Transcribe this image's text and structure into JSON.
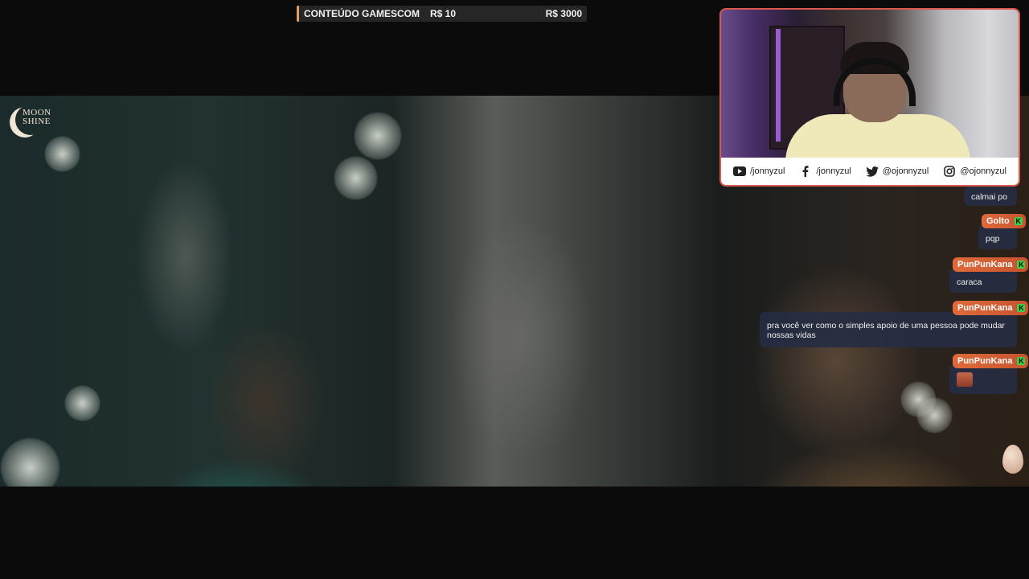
{
  "goal": {
    "title": "CONTEÚDO GAMESCOM",
    "current": "R$ 10",
    "target": "R$ 3000",
    "progress_fraction": 0.003,
    "accent": "#e0a060"
  },
  "video": {
    "logo_text_line1": "MOON",
    "logo_text_line2": "SHINE"
  },
  "webcam": {
    "border_color": "#d85a4a",
    "socials": [
      {
        "icon": "youtube-icon",
        "handle": "/jonnyzul"
      },
      {
        "icon": "facebook-icon",
        "handle": "/jonnyzul"
      },
      {
        "icon": "twitter-icon",
        "handle": "@ojonnyzul"
      },
      {
        "icon": "instagram-icon",
        "handle": "@ojonnyzul"
      }
    ]
  },
  "chat": {
    "messages": [
      {
        "user": "",
        "text": "calmai po"
      },
      {
        "user": "Golto",
        "text": "pqp"
      },
      {
        "user": "PunPunKana",
        "text": "caraca"
      },
      {
        "user": "PunPunKana",
        "text": "pra você ver como o simples apoio de uma pessoa pode mudar nossas vidas"
      },
      {
        "user": "PunPunKana",
        "text": "",
        "emote": "emote-icon"
      }
    ],
    "name_badge_color": "#e06a3a",
    "bubble_color": "#262c42"
  }
}
